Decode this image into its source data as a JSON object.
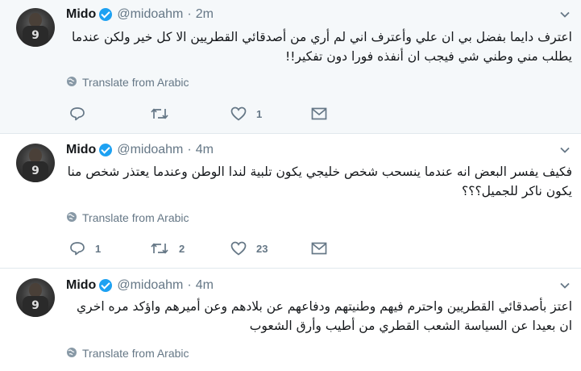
{
  "tweets": [
    {
      "name": "Mido",
      "handle": "@midoahm",
      "separator": "·",
      "time": "2m",
      "text": "اعترف دايما بفضل بي ان علي وأعترف اني لم أري من أصدقائي القطريين الا كل خير ولكن عندما يطلب مني وطني شي فيجب ان أنفذه فورا دون تفكير!!",
      "translate": "Translate from Arabic",
      "reply_count": "",
      "retweet_count": "",
      "like_count": "1",
      "avatar_number": "9"
    },
    {
      "name": "Mido",
      "handle": "@midoahm",
      "separator": "·",
      "time": "4m",
      "text": "فكيف يفسر البعض انه عندما ينسحب شخص خليجي يكون تلبية لندا الوطن وعندما يعتذر شخص منا يكون ناكر للجميل؟؟؟",
      "translate": "Translate from Arabic",
      "reply_count": "1",
      "retweet_count": "2",
      "like_count": "23",
      "avatar_number": "9"
    },
    {
      "name": "Mido",
      "handle": "@midoahm",
      "separator": "·",
      "time": "4m",
      "text": "اعتز بأصدقائي القطريين واحترم فيهم وطنيتهم ودفاعهم عن بلادهم وعن أميرهم واؤكد مره اخري ان بعيدا عن السياسة الشعب القطري من أطيب وأرق الشعوب",
      "translate": "Translate from Arabic",
      "reply_count": "",
      "retweet_count": "",
      "like_count": "",
      "avatar_number": "9"
    }
  ],
  "icons": {
    "verified": "verified-badge-icon",
    "globe": "globe-icon",
    "reply": "reply-icon",
    "retweet": "retweet-icon",
    "like": "heart-icon",
    "dm": "envelope-icon",
    "caret": "chevron-down-icon"
  },
  "colors": {
    "accent": "#1da1f2",
    "secondary_text": "#657786",
    "divider": "#e1e8ed",
    "highlight_bg": "#f5f8fa"
  }
}
